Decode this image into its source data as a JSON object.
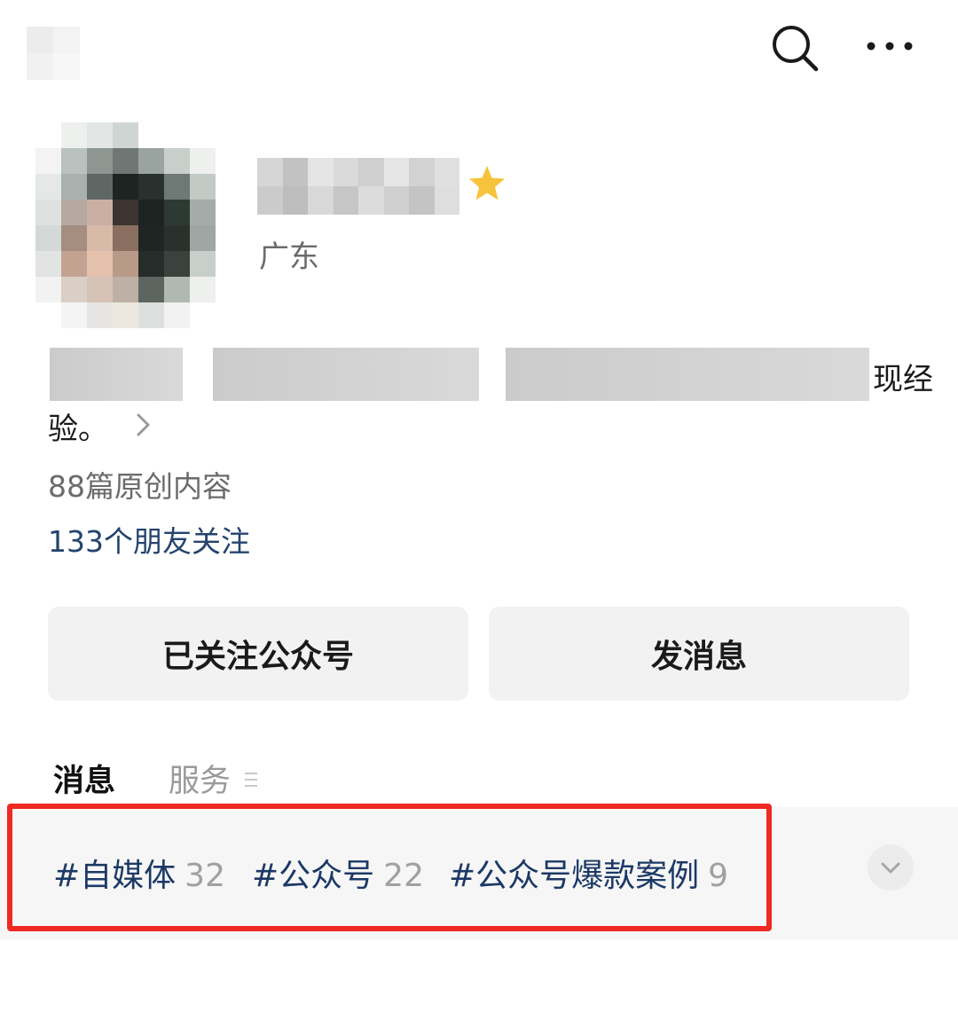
{
  "topbar": {
    "icons": {
      "search": "search-icon",
      "more": "more-icon"
    }
  },
  "profile": {
    "region": "广东",
    "bio_line1_visible": "现经",
    "bio_line2": "验。",
    "original_count_text": "88篇原创内容",
    "friends_follow_text": "133个朋友关注"
  },
  "actions": {
    "follow_label": "已关注公众号",
    "message_label": "发消息"
  },
  "tabs": [
    {
      "label": "消息",
      "active": true
    },
    {
      "label": "服务",
      "active": false
    }
  ],
  "tags": [
    {
      "label": "#自媒体",
      "count": "32"
    },
    {
      "label": "#公众号",
      "count": "22"
    },
    {
      "label": "#公众号爆款案例",
      "count": "9"
    }
  ],
  "colors": {
    "link": "#24446e",
    "tag": "#1c3966",
    "highlight": "#ee2a23",
    "muted": "#6b6b6b"
  }
}
